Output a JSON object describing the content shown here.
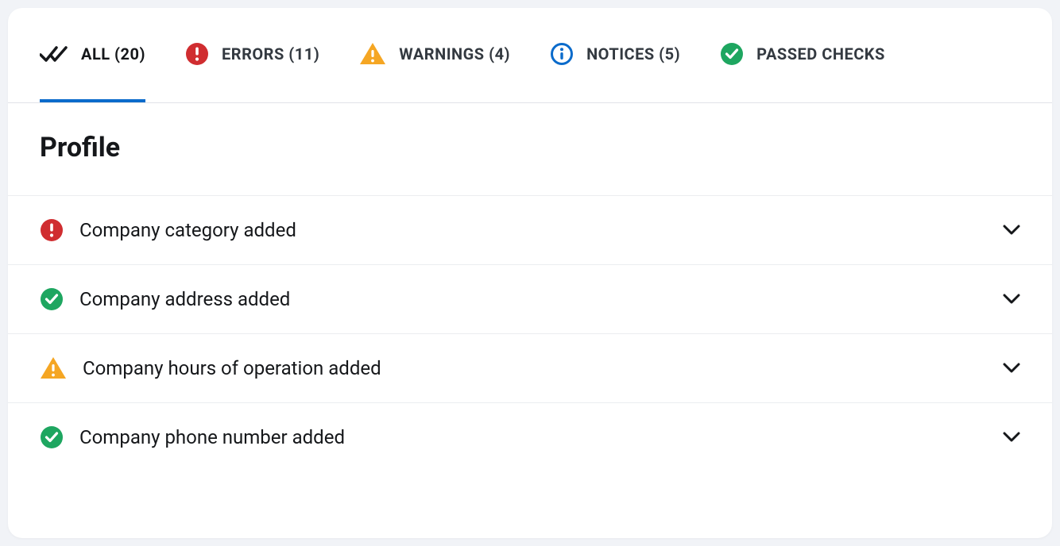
{
  "tabs": {
    "all": {
      "label": "ALL (20)",
      "active": true
    },
    "errors": {
      "label": "ERRORS (11)"
    },
    "warnings": {
      "label": "WARNINGS (4)"
    },
    "notices": {
      "label": "NOTICES (5)"
    },
    "passed": {
      "label": "PASSED CHECKS"
    }
  },
  "section": {
    "title": "Profile"
  },
  "checks": {
    "0": {
      "label": "Company category added",
      "status": "error"
    },
    "1": {
      "label": "Company address added",
      "status": "passed"
    },
    "2": {
      "label": "Company hours of operation added",
      "status": "warning"
    },
    "3": {
      "label": "Company phone number added",
      "status": "passed"
    }
  },
  "colors": {
    "error": "#d02d30",
    "passed": "#1ea660",
    "warning": "#f5a623",
    "notice": "#0b6bcb",
    "accent": "#0b6bcb"
  }
}
